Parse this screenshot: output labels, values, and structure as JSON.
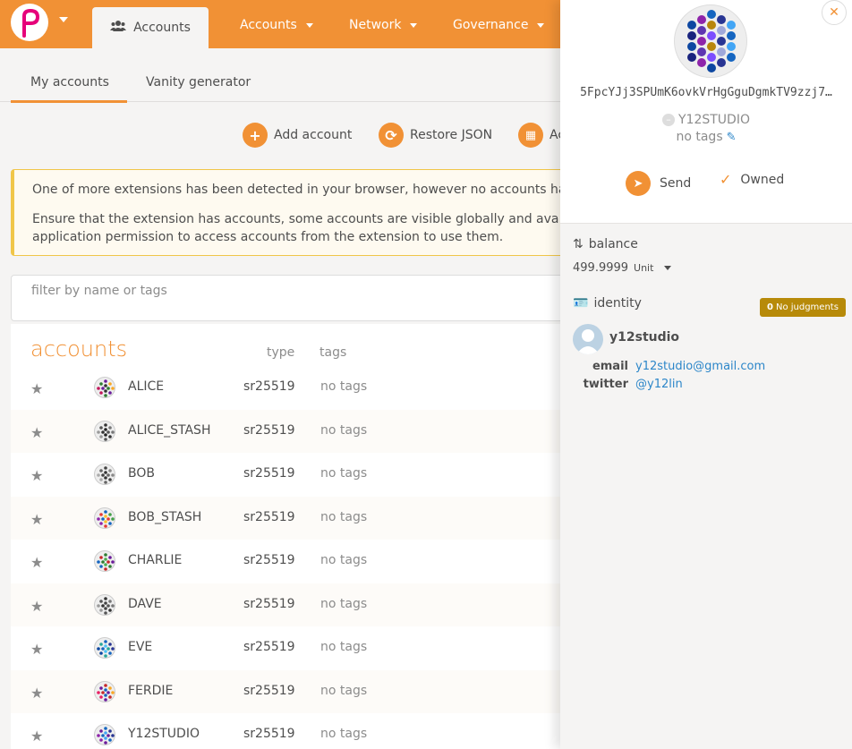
{
  "nav": {
    "active_tab": "Accounts",
    "items": [
      {
        "label": "Accounts"
      },
      {
        "label": "Network"
      },
      {
        "label": "Governance"
      }
    ]
  },
  "subtabs": [
    "My accounts",
    "Vanity generator"
  ],
  "actions": {
    "add": "Add account",
    "restore": "Restore JSON",
    "qr": "Ac"
  },
  "warning": {
    "line1": "One of more extensions has been detected in your browser, however no accounts ha",
    "line2": "Ensure that the extension has accounts, some accounts are visible globally and ava",
    "line3": "application permission to access accounts from the extension to use them."
  },
  "filter": {
    "placeholder": "filter by name or tags"
  },
  "table": {
    "title": "accounts",
    "col_type": "type",
    "col_tags": "tags",
    "rows": [
      {
        "name": "ALICE",
        "type": "sr25519",
        "tags": "no tags"
      },
      {
        "name": "ALICE_STASH",
        "type": "sr25519",
        "tags": "no tags"
      },
      {
        "name": "BOB",
        "type": "sr25519",
        "tags": "no tags"
      },
      {
        "name": "BOB_STASH",
        "type": "sr25519",
        "tags": "no tags"
      },
      {
        "name": "CHARLIE",
        "type": "sr25519",
        "tags": "no tags"
      },
      {
        "name": "DAVE",
        "type": "sr25519",
        "tags": "no tags"
      },
      {
        "name": "EVE",
        "type": "sr25519",
        "tags": "no tags"
      },
      {
        "name": "FERDIE",
        "type": "sr25519",
        "tags": "no tags"
      },
      {
        "name": "Y12STUDIO",
        "type": "sr25519",
        "tags": "no tags"
      }
    ]
  },
  "sidebar": {
    "address": "5FpcYJj3SPUmK6ovkVrHgGguDgmkTV9zzj7…",
    "name": "Y12STUDIO",
    "tags": "no tags",
    "send": "Send",
    "owned": "Owned",
    "balance_label": "balance",
    "balance_value": "499.9999",
    "balance_unit": "Unit",
    "identity_label": "identity",
    "judgements_count": "0",
    "judgements_text": "No judgments",
    "identity_name": "y12studio",
    "email_key": "email",
    "email_val": "y12studio@gmail.com",
    "twitter_key": "twitter",
    "twitter_val": "@y12lin"
  },
  "colors": {
    "brand": "#f19135",
    "link": "#2c86c9",
    "badge": "#b78a09"
  }
}
